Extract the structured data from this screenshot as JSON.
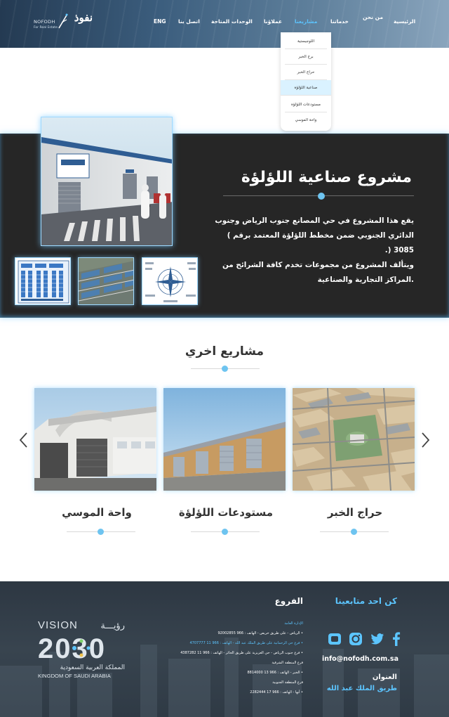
{
  "header": {
    "logo": {
      "arabic": "نفوذ",
      "english": "NOFODH",
      "tagline": "For Real Estate"
    },
    "nav": [
      {
        "label": "الرئيسية"
      },
      {
        "label": "من نحن"
      },
      {
        "label": "خدماتنا"
      },
      {
        "label": "مشاريعنا",
        "active": true
      },
      {
        "label": "عملاؤنا"
      },
      {
        "label": "الوحدات المتاحة"
      },
      {
        "label": "اتصل بنا"
      },
      {
        "label": "ENG"
      }
    ],
    "dropdown": [
      {
        "label": "اللوجيستية"
      },
      {
        "label": "برج الخبر"
      },
      {
        "label": "حراج الخبر"
      },
      {
        "label": "صناعية اللؤلؤة",
        "active": true
      },
      {
        "label": "مستودعات اللؤلؤة"
      },
      {
        "label": "واحة الموسي"
      }
    ]
  },
  "feature": {
    "title": "مشروع صناعية اللؤلؤة",
    "description": [
      "يقع هذا المشروع في حي المصانع جنوب الرياض وجنوب",
      "الدائري الجنوبي ضمن مخطط اللؤلؤة المعتمد برقم ) 3085 (.",
      "ويتألف المشروع من مجموعات تخدم كافة الشرائح من",
      ".المراكز التجارية والصناعية"
    ],
    "thumbnails": [
      "site-plan",
      "aerial-view",
      "location-map"
    ]
  },
  "other_projects": {
    "title": "مشاريع اخري",
    "cards": [
      {
        "title": "واحة الموسي"
      },
      {
        "title": "مستودعات اللؤلؤة"
      },
      {
        "title": "حراج الخبر"
      }
    ]
  },
  "footer": {
    "follow_title": "كن احد متابعينا",
    "social": [
      "youtube-icon",
      "instagram-icon",
      "twitter-icon",
      "facebook-icon"
    ],
    "email": "info@nofodh.com.sa",
    "address_label": "العنوان",
    "address_value": "طريق الملك عبد الله",
    "branches_title": "الفروع",
    "branches": [
      {
        "text": "الإدارة العامة",
        "head": true
      },
      {
        "text": "• الرياض - على طريق خريص - الهاتف : 966 92002855"
      },
      {
        "text": "• فرع حي الرحمانية على طريق الملك عبد الله - الهاتف : 966 11 4707777",
        "highlight": true
      },
      {
        "text": "• فرع جنوب الرياض - حي العزيزية على طريق الحائر - الهاتف : 966 11 4387282"
      },
      {
        "text": "فرع المنطقة الشرقية"
      },
      {
        "text": "• الخبر - الهاتف : 966 13 8814000"
      },
      {
        "text": "فرع المنطقة الجنوبية"
      },
      {
        "text": "• أبها - الهاتف : 966 17 2282444"
      }
    ],
    "vision": {
      "top": "VISION",
      "top_ar": "رؤيـــة",
      "year": "2030",
      "ar": "المملكة العربية السعودية",
      "en": "KINGDOM OF SAUDI ARABIA"
    }
  },
  "colors": {
    "accent": "#5cc5ff",
    "dark_band": "#262626",
    "footer": "#323d48"
  }
}
